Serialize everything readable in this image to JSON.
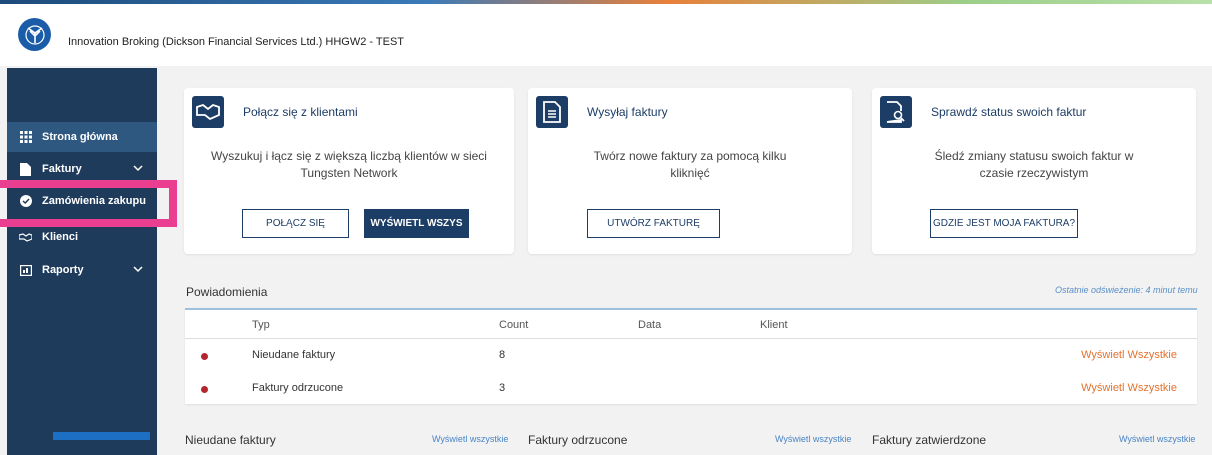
{
  "header": {
    "title": "Innovation Broking (Dickson Financial Services Ltd.) HHGW2 - TEST"
  },
  "sidebar": {
    "items": [
      {
        "label": "Strona główna",
        "icon": "grid-icon"
      },
      {
        "label": "Faktury",
        "icon": "document-icon"
      },
      {
        "label": "Zamówienia zakupu",
        "icon": "check-circle-icon"
      },
      {
        "label": "Klienci",
        "icon": "handshake-icon"
      },
      {
        "label": "Raporty",
        "icon": "report-icon"
      }
    ]
  },
  "cards": [
    {
      "title": "Połącz się z klientami",
      "desc": "Wyszukuj i łącz się z większą liczbą klientów w sieci Tungsten Network",
      "btn1": "POŁĄCZ SIĘ",
      "btn2": "WYŚWIETL WSZYS"
    },
    {
      "title": "Wysyłaj faktury",
      "desc": "Twórz nowe faktury za pomocą kilku kliknięć",
      "btn1": "UTWÓRZ FAKTURĘ"
    },
    {
      "title": "Sprawdź status swoich faktur",
      "desc": "Śledź zmiany statusu swoich faktur w czasie rzeczywistym",
      "btn1": "GDZIE JEST MOJA FAKTURA?"
    }
  ],
  "notifications": {
    "title": "Powiadomienia",
    "refresh": "Ostatnie odświeżenie: 4 minut temu",
    "columns": [
      "Typ",
      "Count",
      "Data",
      "Klient"
    ],
    "rows": [
      {
        "type": "Nieudane faktury",
        "count": "8",
        "link": "Wyświetl Wszystkie"
      },
      {
        "type": "Faktury odrzucone",
        "count": "3",
        "link": "Wyświetl Wszystkie"
      }
    ]
  },
  "bottom": [
    {
      "title": "Nieudane faktury",
      "link": "Wyświetl wszystkie"
    },
    {
      "title": "Faktury odrzucone",
      "link": "Wyświetl wszystkie"
    },
    {
      "title": "Faktury zatwierdzone",
      "link": "Wyświetl wszystkie"
    }
  ],
  "colors": {
    "navy": "#1c3d66",
    "sidebar": "#1e3b5c",
    "accent_orange": "#e2722e",
    "highlight_pink": "#ea3f91"
  }
}
